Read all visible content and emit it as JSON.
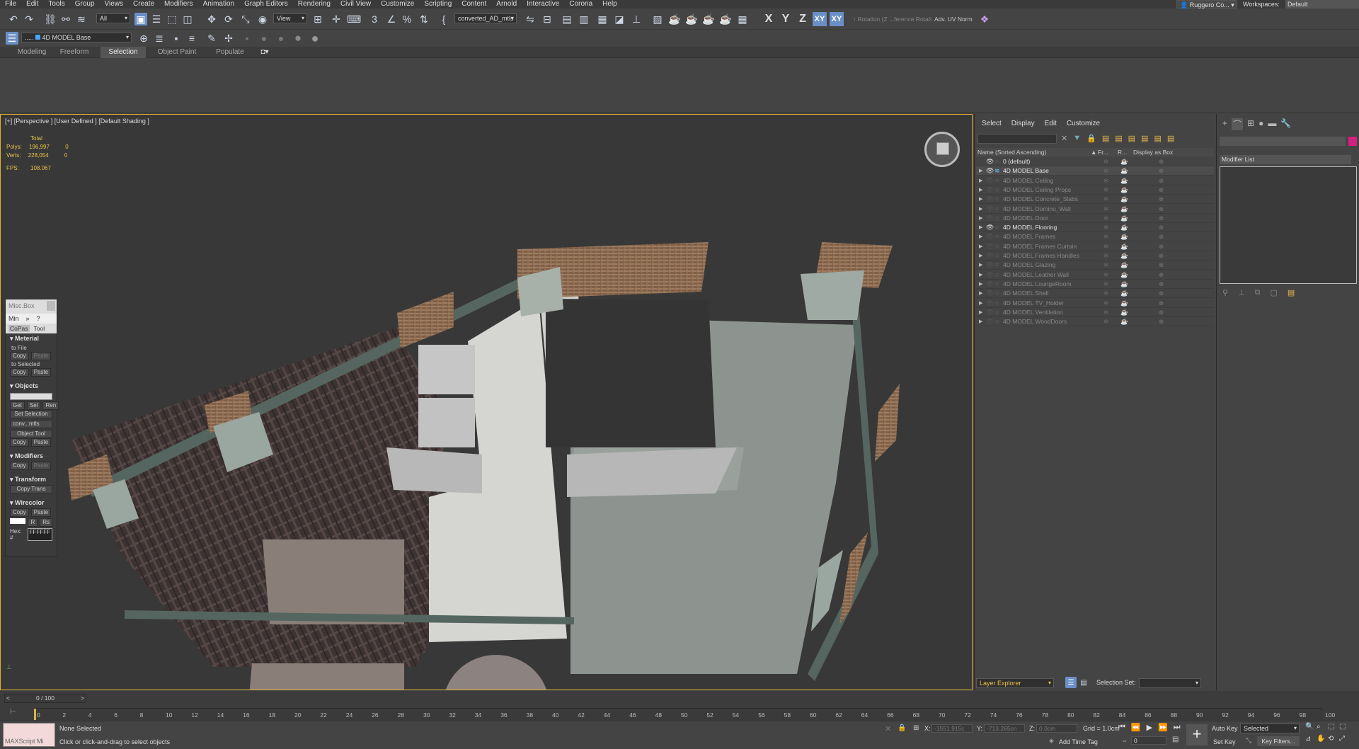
{
  "menu": [
    "File",
    "Edit",
    "Tools",
    "Group",
    "Views",
    "Create",
    "Modifiers",
    "Animation",
    "Graph Editors",
    "Rendering",
    "Civil View",
    "Customize",
    "Scripting",
    "Content",
    "Arnold",
    "Interactive",
    "Corona",
    "Help"
  ],
  "user": {
    "name": "Ruggero Co..."
  },
  "workspace": {
    "label": "Workspaces:",
    "value": "Default"
  },
  "toolbar": {
    "selection_filter": "All",
    "ref_coord": "View",
    "named_selection": "converted_AD_mtls",
    "axes": [
      "X",
      "Y",
      "Z"
    ],
    "axis_pair": "XY",
    "axis_pair2": "XY",
    "adv_uv": "Adv. UV Norm",
    "rotation_hint": "↑ Rotation (Z ...ference Rotati"
  },
  "layer_toolbar": {
    "current_layer": "4D MODEL Base",
    "prefix": "....."
  },
  "ribbon_tabs": [
    "Modeling",
    "Freeform",
    "Selection",
    "Object Paint",
    "Populate"
  ],
  "viewport": {
    "label": "[+] [Perspective ] [User Defined ] [Default Shading ]",
    "stats": {
      "total": "Total",
      "polys_label": "Polys:",
      "polys": "196,997",
      "polys_sel": "0",
      "verts_label": "Verts:",
      "verts": "228,054",
      "verts_sel": "0",
      "fps_label": "FPS:",
      "fps": "108.067"
    }
  },
  "misc_panel": {
    "title": "Misc.Box",
    "min": "Min",
    "sep": "»",
    "help": "?",
    "tabs": [
      "CoPas",
      "Tool"
    ],
    "material": {
      "header": "Meterial",
      "to_file": "to File",
      "to_selected": "to Selected",
      "copy": "Copy",
      "paste": "Paste"
    },
    "objects": {
      "header": "Objects",
      "get": "Get",
      "sel": "Sel",
      "ren": "Ren",
      "set_selection": "Set Selection",
      "dropdown": "conv...mtls",
      "object_tool": "Object Tool",
      "copy": "Copy",
      "paste": "Paste"
    },
    "modifiers": {
      "header": "Modifiers",
      "copy": "Copy",
      "paste": "Paste"
    },
    "transform": {
      "header": "Transform",
      "copy_trans": "Copy Trans"
    },
    "wirecolor": {
      "header": "Wirecolor",
      "copy": "Copy",
      "paste": "Paste",
      "r": "R",
      "rs": "Rs",
      "hex_label": "Hex: #",
      "hex": "FFFFFF"
    }
  },
  "layer_explorer": {
    "menu": [
      "Select",
      "Display",
      "Edit",
      "Customize"
    ],
    "columns": {
      "name": "Name (Sorted Ascending)",
      "fr": "Fr...",
      "r": "R...",
      "box": "Display as Box"
    },
    "rows": [
      {
        "name": "0 (default)",
        "bright": true,
        "expand": false,
        "eye": true
      },
      {
        "name": "4D MODEL Base",
        "bright": true,
        "expand": true,
        "eye": true,
        "sel": true
      },
      {
        "name": "4D MODEL Ceiling",
        "bright": false,
        "expand": true,
        "eye": false
      },
      {
        "name": "4D MODEL Ceiling Props",
        "bright": false,
        "expand": true,
        "eye": false
      },
      {
        "name": "4D MODEL Concrete_Slabs",
        "bright": false,
        "expand": true,
        "eye": false
      },
      {
        "name": "4D MODEL Domino_Wall",
        "bright": false,
        "expand": true,
        "eye": false
      },
      {
        "name": "4D MODEL Door",
        "bright": false,
        "expand": true,
        "eye": false
      },
      {
        "name": "4D MODEL Flooring",
        "bright": true,
        "expand": true,
        "eye": true
      },
      {
        "name": "4D MODEL Frames",
        "bright": false,
        "expand": true,
        "eye": false
      },
      {
        "name": "4D MODEL Frames Curtain",
        "bright": false,
        "expand": true,
        "eye": false
      },
      {
        "name": "4D MODEL Frames Handles",
        "bright": false,
        "expand": true,
        "eye": false
      },
      {
        "name": "4D MODEL Glazing",
        "bright": false,
        "expand": true,
        "eye": false
      },
      {
        "name": "4D MODEL Leather Wall",
        "bright": false,
        "expand": true,
        "eye": false
      },
      {
        "name": "4D MODEL LoungeRoom",
        "bright": false,
        "expand": true,
        "eye": false
      },
      {
        "name": "4D MODEL Shell",
        "bright": false,
        "expand": true,
        "eye": false
      },
      {
        "name": "4D MODEL TV_Holder",
        "bright": false,
        "expand": true,
        "eye": false
      },
      {
        "name": "4D MODEL Ventilation",
        "bright": false,
        "expand": true,
        "eye": false
      },
      {
        "name": "4D MODEL WoodDoors",
        "bright": false,
        "expand": true,
        "eye": false
      }
    ],
    "footer": {
      "explorer": "Layer Explorer",
      "selection_set": "Selection Set:"
    }
  },
  "modify_panel": {
    "modifier_list": "Modifier List"
  },
  "timeline": {
    "frame": "0 / 100",
    "ticks": [
      "0",
      "2",
      "4",
      "6",
      "8",
      "10",
      "12",
      "14",
      "16",
      "18",
      "20",
      "22",
      "24",
      "26",
      "28",
      "30",
      "32",
      "34",
      "36",
      "38",
      "40",
      "42",
      "44",
      "46",
      "48",
      "50",
      "52",
      "54",
      "56",
      "58",
      "60",
      "62",
      "64",
      "66",
      "68",
      "70",
      "72",
      "74",
      "76",
      "78",
      "80",
      "82",
      "84",
      "86",
      "88",
      "90",
      "92",
      "94",
      "96",
      "98",
      "100"
    ]
  },
  "status": {
    "maxscript": "MAXScript Mi",
    "selection": "None Selected",
    "prompt": "Click or click-and-drag to select objects",
    "x_label": "X:",
    "x": "-1551.915c",
    "y_label": "Y:",
    "y": "-713.265cn",
    "z_label": "Z:",
    "z": "0.0cm",
    "grid": "Grid = 1.0cm",
    "add_time_tag": "Add Time Tag",
    "auto_key": "Auto Key",
    "selected": "Selected",
    "set_key": "Set Key",
    "key_filters": "Key Filters...",
    "frame_value": "0"
  }
}
